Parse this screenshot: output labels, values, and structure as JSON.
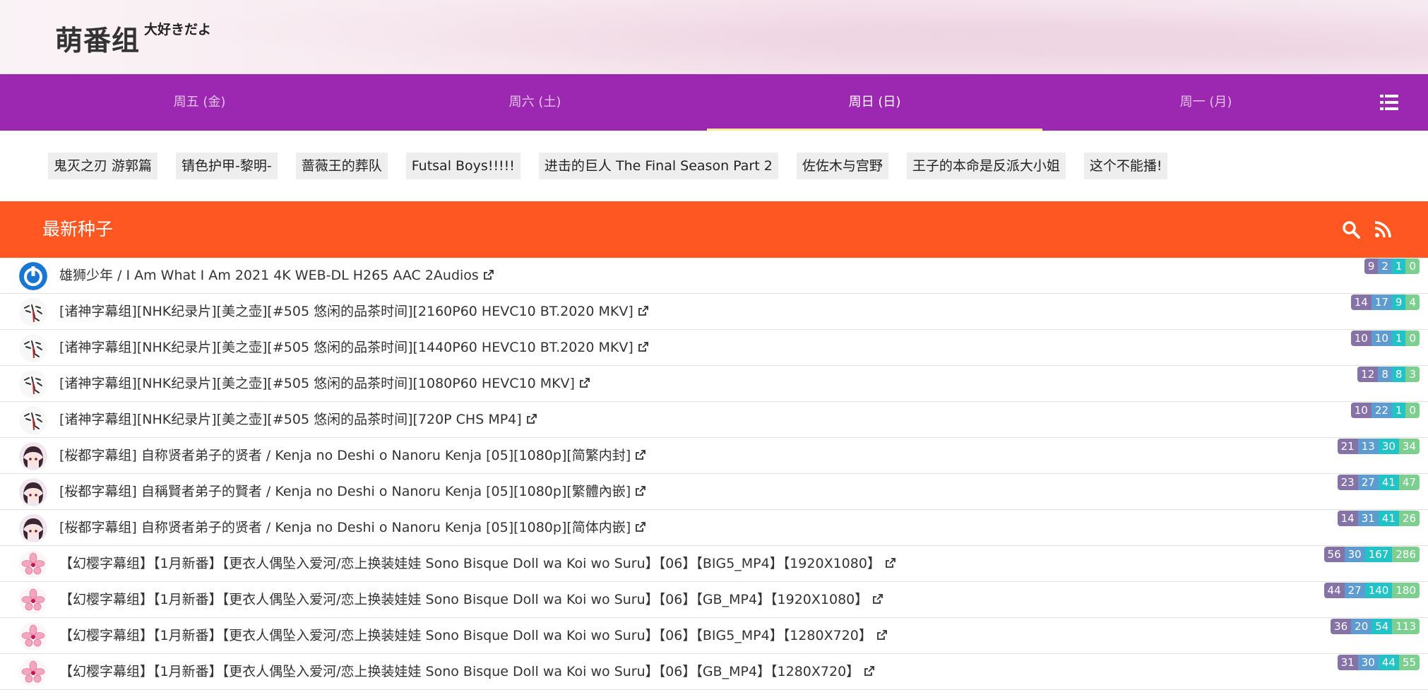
{
  "header": {
    "logo_main": "萌番组",
    "logo_sub": "大好きだよ"
  },
  "nav": {
    "tabs": [
      {
        "label": "周五 (金)",
        "active": false
      },
      {
        "label": "周六 (土)",
        "active": false
      },
      {
        "label": "周日 (日)",
        "active": true
      },
      {
        "label": "周一 (月)",
        "active": false
      }
    ],
    "menu_icon": "list-menu-icon"
  },
  "chips": [
    "鬼灭之刃 游郭篇",
    "锖色护甲-黎明-",
    "蔷薇王的葬队",
    "Futsal Boys!!!!!",
    "进击的巨人 The Final Season Part 2",
    "佐佐木与宫野",
    "王子的本命是反派大小姐",
    "这个不能播!"
  ],
  "section": {
    "title": "最新种子",
    "search_icon": "search-icon",
    "rss_icon": "rss-icon"
  },
  "colors": {
    "nav": "#9c27b0",
    "section": "#ff5722",
    "active_underline": "#ffeb99"
  },
  "torrents": [
    {
      "avatar": "blue",
      "title": "雄狮少年 / I Am What I Am 2021 4K WEB-DL H265 AAC 2Audios",
      "stats": [
        "9",
        "2",
        "1",
        "0"
      ]
    },
    {
      "avatar": "ink",
      "title": "[诸神字幕组][NHK纪录片][美之壶][#505 悠闲的品茶时间][2160P60 HEVC10 BT.2020 MKV]",
      "stats": [
        "14",
        "17",
        "9",
        "4"
      ]
    },
    {
      "avatar": "ink",
      "title": "[诸神字幕组][NHK纪录片][美之壶][#505 悠闲的品茶时间][1440P60 HEVC10 BT.2020 MKV]",
      "stats": [
        "10",
        "10",
        "1",
        "0"
      ]
    },
    {
      "avatar": "ink",
      "title": "[诸神字幕组][NHK纪录片][美之壶][#505 悠闲的品茶时间][1080P60 HEVC10 MKV]",
      "stats": [
        "12",
        "8",
        "8",
        "3"
      ]
    },
    {
      "avatar": "ink",
      "title": "[诸神字幕组][NHK纪录片][美之壶][#505 悠闲的品茶时间][720P CHS MP4]",
      "stats": [
        "10",
        "22",
        "1",
        "0"
      ]
    },
    {
      "avatar": "anime",
      "title": "[桜都字幕组] 自称贤者弟子的贤者 / Kenja no Deshi o Nanoru Kenja [05][1080p][简繁内封]",
      "stats": [
        "21",
        "13",
        "30",
        "34"
      ]
    },
    {
      "avatar": "anime",
      "title": "[桜都字幕组] 自稱賢者弟子的賢者 / Kenja no Deshi o Nanoru Kenja [05][1080p][繁體內嵌]",
      "stats": [
        "23",
        "27",
        "41",
        "47"
      ]
    },
    {
      "avatar": "anime",
      "title": "[桜都字幕组] 自称贤者弟子的贤者 / Kenja no Deshi o Nanoru Kenja [05][1080p][简体内嵌]",
      "stats": [
        "14",
        "31",
        "41",
        "26"
      ]
    },
    {
      "avatar": "sakura",
      "title": "【幻樱字幕组】【1月新番】【更衣人偶坠入爱河/恋上换装娃娃 Sono Bisque Doll wa Koi wo Suru】【06】【BIG5_MP4】【1920X1080】",
      "stats": [
        "56",
        "30",
        "167",
        "286"
      ]
    },
    {
      "avatar": "sakura",
      "title": "【幻樱字幕组】【1月新番】【更衣人偶坠入爱河/恋上换装娃娃 Sono Bisque Doll wa Koi wo Suru】【06】【GB_MP4】【1920X1080】",
      "stats": [
        "44",
        "27",
        "140",
        "180"
      ]
    },
    {
      "avatar": "sakura",
      "title": "【幻樱字幕组】【1月新番】【更衣人偶坠入爱河/恋上换装娃娃 Sono Bisque Doll wa Koi wo Suru】【06】【BIG5_MP4】【1280X720】",
      "stats": [
        "36",
        "20",
        "54",
        "113"
      ]
    },
    {
      "avatar": "sakura",
      "title": "【幻樱字幕组】【1月新番】【更衣人偶坠入爱河/恋上换装娃娃 Sono Bisque Doll wa Koi wo Suru】【06】【GB_MP4】【1280X720】",
      "stats": [
        "31",
        "30",
        "44",
        "55"
      ]
    }
  ]
}
